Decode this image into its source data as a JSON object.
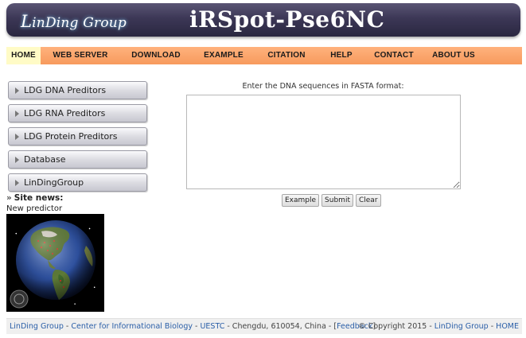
{
  "header": {
    "logo_text_1": "L",
    "logo_text_2": "inDing Group",
    "site_title": "iRSpot-Pse6NC"
  },
  "nav": {
    "items": [
      "HOME",
      "WEB SERVER",
      "DOWNLOAD",
      "EXAMPLE",
      "CITATION",
      "HELP",
      "CONTACT",
      "ABOUT US"
    ],
    "active": "HOME"
  },
  "sidebar": {
    "items": [
      {
        "label": "LDG DNA Preditors"
      },
      {
        "label": "LDG RNA Preditors"
      },
      {
        "label": "LDG Protein Preditors"
      },
      {
        "label": "Database"
      },
      {
        "label": "LinDingGroup"
      }
    ],
    "news_heading": "Site news:",
    "news_items": [
      "New predictor"
    ]
  },
  "form": {
    "prompt": "Enter the DNA sequences in FASTA format:",
    "textarea_value": "",
    "buttons": {
      "example": "Example",
      "submit": "Submit",
      "clear": "Clear"
    }
  },
  "footer": {
    "org": "LinDing Group",
    "sep1": " - ",
    "center": "Center for Informational Biology",
    "sep2": " - ",
    "univ": "UESTC",
    "address": " - Chengdu, 610054, China - [",
    "feedback": "Feedback",
    "close_bracket": "]",
    "copyright": "© Copyright 2015 - ",
    "copy_org": "LinDing Group",
    "sep3": " - ",
    "home": "HOME"
  },
  "colors": {
    "header_bg": "#3c3756",
    "nav_bg": "#f79a5d",
    "nav_active_bg": "#fffbc6",
    "link": "#2b5fa8"
  }
}
